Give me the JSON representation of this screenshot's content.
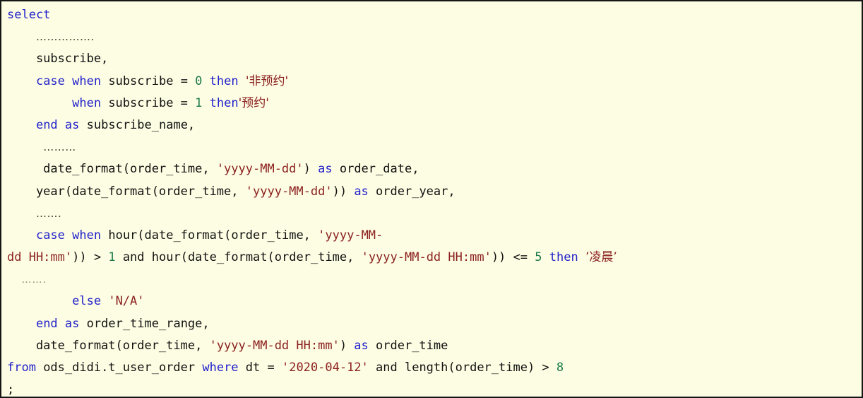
{
  "editor": {
    "language": "sql",
    "background_color": "#fdfde3",
    "border_color": "#161616",
    "colors": {
      "keyword": "#2222cc",
      "string": "#8b2020",
      "number": "#1a7a4a",
      "identifier": "#111111",
      "ellipsis": "#3a3a2e",
      "ellipsis_faded": "#8f8f7a"
    }
  },
  "code": {
    "full_text": "select\n    …………….\n    subscribe,\n    case when subscribe = 0 then '非预约'\n         when subscribe = 1 then'预约'\n    end as subscribe_name,\n     ………\n     date_format(order_time, 'yyyy-MM-dd') as order_date,\n    year(date_format(order_time, 'yyyy-MM-dd')) as order_year,\n    …….\n    case when hour(date_format(order_time, 'yyyy-MM-dd HH:mm')) > 1 and hour(date_format(order_time, 'yyyy-MM-dd HH:mm')) <= 5 then '凌晨'\n  …….\n         else 'N/A'\n    end as order_time_range,\n    date_format(order_time, 'yyyy-MM-dd HH:mm') as order_time\nfrom ods_didi.t_user_order where dt = '2020-04-12' and length(order_time) > 8\n;",
    "lines": [
      {
        "n": 1,
        "indent": "",
        "text": "select"
      },
      {
        "n": 2,
        "indent": "    ",
        "text": "…………….",
        "kind": "ellipsis"
      },
      {
        "n": 3,
        "indent": "    ",
        "text": "subscribe,"
      },
      {
        "n": 4,
        "indent": "    ",
        "text": "case when subscribe = 0 then '非预约'"
      },
      {
        "n": 5,
        "indent": "         ",
        "text": "when subscribe = 1 then'预约'"
      },
      {
        "n": 6,
        "indent": "    ",
        "text": "end as subscribe_name,"
      },
      {
        "n": 7,
        "indent": "     ",
        "text": "………",
        "kind": "ellipsis"
      },
      {
        "n": 8,
        "indent": "     ",
        "text": "date_format(order_time, 'yyyy-MM-dd') as order_date,"
      },
      {
        "n": 9,
        "indent": "    ",
        "text": "year(date_format(order_time, 'yyyy-MM-dd')) as order_year,"
      },
      {
        "n": 10,
        "indent": "    ",
        "text": "…….",
        "kind": "ellipsis"
      },
      {
        "n": 11,
        "indent": "    ",
        "text": "case when hour(date_format(order_time, 'yyyy-MM-dd HH:mm')) > 1 and hour(date_format(order_time, 'yyyy-MM-dd HH:mm')) <= 5 then '凌晨'",
        "wrapped": true
      },
      {
        "n": 12,
        "indent": "  ",
        "text": "…….",
        "kind": "ellipsis-faded"
      },
      {
        "n": 13,
        "indent": "         ",
        "text": "else 'N/A'"
      },
      {
        "n": 14,
        "indent": "    ",
        "text": "end as order_time_range,"
      },
      {
        "n": 15,
        "indent": "    ",
        "text": "date_format(order_time, 'yyyy-MM-dd HH:mm') as order_time"
      },
      {
        "n": 16,
        "indent": "",
        "text": "from ods_didi.t_user_order where dt = '2020-04-12' and length(order_time) > 8"
      },
      {
        "n": 17,
        "indent": "",
        "text": ";"
      }
    ],
    "tokens": {
      "keywords": [
        "select",
        "case",
        "when",
        "then",
        "end",
        "as",
        "else",
        "from",
        "where",
        "and"
      ],
      "identifiers": [
        "subscribe",
        "subscribe_name",
        "date_format",
        "order_time",
        "order_date",
        "year",
        "order_year",
        "hour",
        "order_time_range",
        "ods_didi.t_user_order",
        "dt",
        "length"
      ],
      "strings": [
        "'非预约'",
        "'预约'",
        "'yyyy-MM-dd'",
        "'yyyy-MM-dd HH:mm'",
        "'凌晨'",
        "'N/A'",
        "'2020-04-12'"
      ],
      "numbers": [
        "0",
        "1",
        "5",
        "8"
      ]
    },
    "segments": [
      [
        {
          "t": "select",
          "c": "kw"
        }
      ],
      [
        {
          "t": "    ",
          "c": "id"
        },
        {
          "t": "…………….",
          "c": "dots"
        }
      ],
      [
        {
          "t": "    subscribe,",
          "c": "id"
        }
      ],
      [
        {
          "t": "    ",
          "c": "id"
        },
        {
          "t": "case",
          "c": "kw"
        },
        {
          "t": " ",
          "c": "id"
        },
        {
          "t": "when",
          "c": "kw"
        },
        {
          "t": " subscribe = ",
          "c": "id"
        },
        {
          "t": "0",
          "c": "num"
        },
        {
          "t": " ",
          "c": "id"
        },
        {
          "t": "then",
          "c": "kw"
        },
        {
          "t": " ",
          "c": "id"
        },
        {
          "t": "'非预约'",
          "c": "str"
        }
      ],
      [
        {
          "t": "         ",
          "c": "id"
        },
        {
          "t": "when",
          "c": "kw"
        },
        {
          "t": " subscribe = ",
          "c": "id"
        },
        {
          "t": "1",
          "c": "num"
        },
        {
          "t": " ",
          "c": "id"
        },
        {
          "t": "then",
          "c": "kw"
        },
        {
          "t": "'预约'",
          "c": "str"
        }
      ],
      [
        {
          "t": "    ",
          "c": "id"
        },
        {
          "t": "end",
          "c": "kw"
        },
        {
          "t": " ",
          "c": "id"
        },
        {
          "t": "as",
          "c": "kw"
        },
        {
          "t": " subscribe_name,",
          "c": "id"
        }
      ],
      [
        {
          "t": "     ",
          "c": "id"
        },
        {
          "t": "………",
          "c": "dots"
        }
      ],
      [
        {
          "t": "     date_format(order_time, ",
          "c": "id"
        },
        {
          "t": "'yyyy-MM-dd'",
          "c": "str"
        },
        {
          "t": ") ",
          "c": "id"
        },
        {
          "t": "as",
          "c": "kw"
        },
        {
          "t": " order_date,",
          "c": "id"
        }
      ],
      [
        {
          "t": "    year(date_format(order_time, ",
          "c": "id"
        },
        {
          "t": "'yyyy-MM-dd'",
          "c": "str"
        },
        {
          "t": ")) ",
          "c": "id"
        },
        {
          "t": "as",
          "c": "kw"
        },
        {
          "t": " order_year,",
          "c": "id"
        }
      ],
      [
        {
          "t": "    ",
          "c": "id"
        },
        {
          "t": "…….",
          "c": "dots"
        }
      ],
      [
        {
          "t": "    ",
          "c": "id"
        },
        {
          "t": "case",
          "c": "kw"
        },
        {
          "t": " ",
          "c": "id"
        },
        {
          "t": "when",
          "c": "kw"
        },
        {
          "t": " hour(date_format(order_time, ",
          "c": "id"
        },
        {
          "t": "'yyyy-MM-",
          "c": "str"
        }
      ],
      [
        {
          "t": "dd HH:mm'",
          "c": "str"
        },
        {
          "t": ")) > ",
          "c": "id"
        },
        {
          "t": "1",
          "c": "num"
        },
        {
          "t": " ",
          "c": "id"
        },
        {
          "t": "and",
          "c": "id"
        },
        {
          "t": " hour(date_format(order_time, ",
          "c": "id"
        },
        {
          "t": "'yyyy-MM-dd HH:mm'",
          "c": "str"
        },
        {
          "t": ")) <= ",
          "c": "id"
        },
        {
          "t": "5",
          "c": "num"
        },
        {
          "t": " ",
          "c": "id"
        },
        {
          "t": "then",
          "c": "kw"
        },
        {
          "t": " ",
          "c": "id"
        },
        {
          "t": "’凌晨’",
          "c": "str"
        }
      ],
      [
        {
          "t": "  ",
          "c": "id"
        },
        {
          "t": "…….",
          "c": "dots-faded"
        }
      ],
      [
        {
          "t": "         ",
          "c": "id"
        },
        {
          "t": "else",
          "c": "kw"
        },
        {
          "t": " ",
          "c": "id"
        },
        {
          "t": "'N/A'",
          "c": "str"
        }
      ],
      [
        {
          "t": "    ",
          "c": "id"
        },
        {
          "t": "end",
          "c": "kw"
        },
        {
          "t": " ",
          "c": "id"
        },
        {
          "t": "as",
          "c": "kw"
        },
        {
          "t": " order_time_range,",
          "c": "id"
        }
      ],
      [
        {
          "t": "    date_format(order_time, ",
          "c": "id"
        },
        {
          "t": "'yyyy-MM-dd HH:mm'",
          "c": "str"
        },
        {
          "t": ") ",
          "c": "id"
        },
        {
          "t": "as",
          "c": "kw"
        },
        {
          "t": " order_time",
          "c": "id"
        }
      ],
      [
        {
          "t": "from",
          "c": "kw"
        },
        {
          "t": " ods_didi.t_user_order ",
          "c": "id"
        },
        {
          "t": "where",
          "c": "kw"
        },
        {
          "t": " dt = ",
          "c": "id"
        },
        {
          "t": "'2020-04-12'",
          "c": "str"
        },
        {
          "t": " and length(order_time) > ",
          "c": "id"
        },
        {
          "t": "8",
          "c": "num"
        }
      ],
      [
        {
          "t": ";",
          "c": "id"
        }
      ]
    ]
  }
}
